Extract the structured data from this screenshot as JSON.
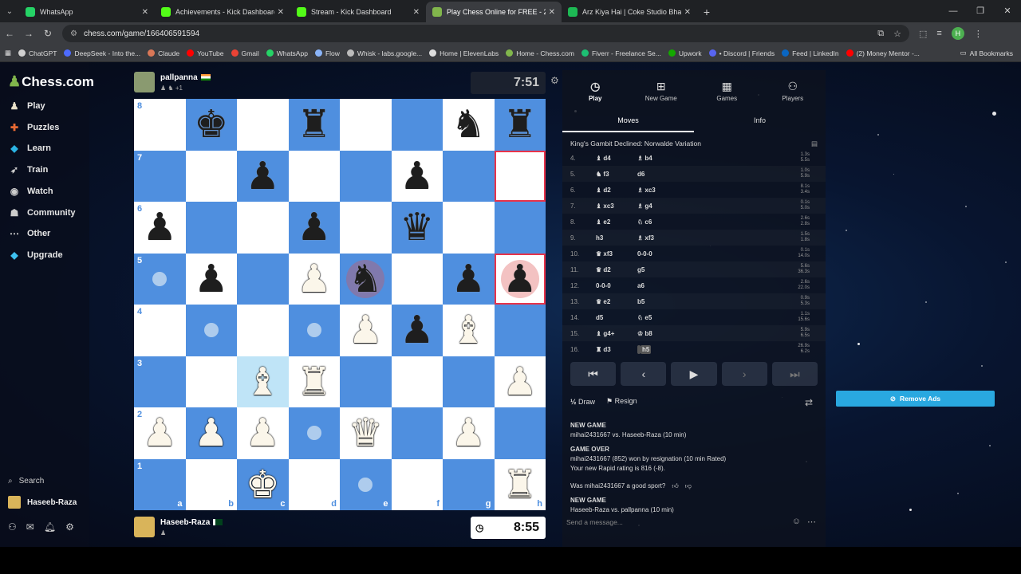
{
  "browser": {
    "tabs": [
      {
        "title": "WhatsApp",
        "icon": "whatsapp-icon",
        "color": "#25d366",
        "active": false
      },
      {
        "title": "Achievements - Kick Dashboard",
        "icon": "kick-icon",
        "color": "#53fc18",
        "active": false
      },
      {
        "title": "Stream - Kick Dashboard",
        "icon": "kick-icon",
        "color": "#53fc18",
        "active": false
      },
      {
        "title": "Play Chess Online for FREE - 2",
        "icon": "chess-icon",
        "color": "#81b64c",
        "active": true
      },
      {
        "title": "Arz Kiya Hai | Coke Studio Bhar",
        "icon": "spotify-icon",
        "color": "#1db954",
        "active": false
      }
    ],
    "url": "chess.com/game/166406591594",
    "bookmarks": [
      {
        "label": "ChatGPT",
        "color": "#d0d0d0"
      },
      {
        "label": "DeepSeek - Into the...",
        "color": "#4d6bfe"
      },
      {
        "label": "Claude",
        "color": "#d97757"
      },
      {
        "label": "YouTube",
        "color": "#ff0000"
      },
      {
        "label": "Gmail",
        "color": "#ea4335"
      },
      {
        "label": "WhatsApp",
        "color": "#25d366"
      },
      {
        "label": "Flow",
        "color": "#8ab4f8"
      },
      {
        "label": "Whisk - labs.google...",
        "color": "#bbbbbb"
      },
      {
        "label": "Home | ElevenLabs",
        "color": "#dddddd"
      },
      {
        "label": "Home - Chess.com",
        "color": "#81b64c"
      },
      {
        "label": "Fiverr - Freelance Se...",
        "color": "#1dbf73"
      },
      {
        "label": "Upwork",
        "color": "#14a800"
      },
      {
        "label": "• Discord | Friends",
        "color": "#5865f2"
      },
      {
        "label": "Feed | LinkedIn",
        "color": "#0a66c2"
      },
      {
        "label": "(2) Money Mentor -...",
        "color": "#ff0000"
      }
    ],
    "all_bookmarks": "All Bookmarks",
    "profile_initial": "H"
  },
  "sidebar": {
    "logo": "Chess.com",
    "items": [
      {
        "label": "Play",
        "icon": "play-icon",
        "color": "#e8e0c8"
      },
      {
        "label": "Puzzles",
        "icon": "puzzle-icon",
        "color": "#e86a33"
      },
      {
        "label": "Learn",
        "icon": "learn-icon",
        "color": "#2bb3e3"
      },
      {
        "label": "Train",
        "icon": "train-icon",
        "color": "#cccccc"
      },
      {
        "label": "Watch",
        "icon": "watch-icon",
        "color": "#cccccc"
      },
      {
        "label": "Community",
        "icon": "community-icon",
        "color": "#cccccc"
      },
      {
        "label": "Other",
        "icon": "more-icon",
        "color": "#cccccc"
      },
      {
        "label": "Upgrade",
        "icon": "diamond-icon",
        "color": "#3ec1f0"
      }
    ],
    "search": "Search",
    "user": "Haseeb-Raza"
  },
  "top_player": {
    "name": "pallpanna",
    "rating_note": "+1",
    "clock": "7:51"
  },
  "bottom_player": {
    "name": "Haseeb-Raza",
    "clock": "8:55"
  },
  "board": {
    "ranks": [
      "8",
      "7",
      "6",
      "5",
      "4",
      "3",
      "2",
      "1"
    ],
    "files": [
      "a",
      "b",
      "c",
      "d",
      "e",
      "f",
      "g",
      "h"
    ],
    "rows": [
      [
        "",
        "bk",
        "",
        "br",
        "",
        "",
        "bn",
        "br"
      ],
      [
        "",
        "",
        "bp",
        "",
        "",
        "bp",
        "",
        ""
      ],
      [
        "bp",
        "",
        "",
        "bp",
        "",
        "bq",
        "",
        ""
      ],
      [
        "",
        "bp",
        "",
        "wp",
        "bn",
        "",
        "bp",
        "bp"
      ],
      [
        "",
        "",
        "",
        "",
        "wp",
        "bp",
        "wb",
        ""
      ],
      [
        "",
        "",
        "wb",
        "wr",
        "",
        "",
        "",
        "wp"
      ],
      [
        "wp",
        "wp",
        "wp",
        "",
        "wq",
        "",
        "wp",
        ""
      ],
      [
        "",
        "",
        "wk",
        "",
        "",
        "",
        "",
        "wr"
      ]
    ],
    "last_move": [
      "h7",
      "h5"
    ],
    "selected": "c3",
    "move_hints": [
      "a5",
      "b4",
      "d4",
      "d2",
      "e1"
    ]
  },
  "panel": {
    "tabs": [
      {
        "label": "Play",
        "icon": "stopwatch-icon"
      },
      {
        "label": "New Game",
        "icon": "plus-icon"
      },
      {
        "label": "Games",
        "icon": "games-icon"
      },
      {
        "label": "Players",
        "icon": "players-icon"
      }
    ],
    "subtabs": [
      "Moves",
      "Info"
    ],
    "opening": "King's Gambit Declined: Norwalde Variation",
    "moves": [
      {
        "n": "4.",
        "w": "d4",
        "wi": "♝",
        "b": "b4",
        "bi": "♗",
        "wt": "1.3s",
        "bt": "5.5s"
      },
      {
        "n": "5.",
        "w": "f3",
        "wi": "♞",
        "b": "d6",
        "bi": "",
        "wt": "1.0s",
        "bt": "5.9s"
      },
      {
        "n": "6.",
        "w": "d2",
        "wi": "♝",
        "b": "xc3",
        "bi": "♗",
        "wt": "8.1s",
        "bt": "3.4s"
      },
      {
        "n": "7.",
        "w": "xc3",
        "wi": "♝",
        "b": "g4",
        "bi": "♗",
        "wt": "0.1s",
        "bt": "5.0s"
      },
      {
        "n": "8.",
        "w": "e2",
        "wi": "♝",
        "b": "c6",
        "bi": "♘",
        "wt": "2.6s",
        "bt": "2.8s"
      },
      {
        "n": "9.",
        "w": "h3",
        "wi": "",
        "b": "xf3",
        "bi": "♗",
        "wt": "1.5s",
        "bt": "1.8s"
      },
      {
        "n": "10.",
        "w": "xf3",
        "wi": "♛",
        "b": "0-0-0",
        "bi": "",
        "wt": "0.1s",
        "bt": "14.0s"
      },
      {
        "n": "11.",
        "w": "d2",
        "wi": "♛",
        "b": "g5",
        "bi": "",
        "wt": "5.6s",
        "bt": "36.3s"
      },
      {
        "n": "12.",
        "w": "0-0-0",
        "wi": "",
        "b": "a6",
        "bi": "",
        "wt": "2.6s",
        "bt": "22.0s"
      },
      {
        "n": "13.",
        "w": "e2",
        "wi": "♛",
        "b": "b5",
        "bi": "",
        "wt": "0.9s",
        "bt": "5.3s"
      },
      {
        "n": "14.",
        "w": "d5",
        "wi": "",
        "b": "e5",
        "bi": "♘",
        "wt": "1.1s",
        "bt": "15.6s"
      },
      {
        "n": "15.",
        "w": "g4+",
        "wi": "♝",
        "b": "b8",
        "bi": "♔",
        "wt": "5.9s",
        "bt": "6.5s"
      },
      {
        "n": "16.",
        "w": "d3",
        "wi": "♜",
        "b": "h5",
        "bi": "",
        "wt": "26.9s",
        "bt": "6.2s"
      }
    ],
    "draw": "Draw",
    "resign": "Resign",
    "log": {
      "new_game_1": "NEW GAME",
      "match_1": "mihai2431667 vs. Haseeb-Raza (10 min)",
      "game_over": "GAME OVER",
      "result": "mihai2431667 (852) won by resignation (10 min Rated)",
      "rating": "Your new Rapid rating is 816 (-8).",
      "ask": "Was mihai2431667 a good sport?",
      "new_game_2": "NEW GAME",
      "match_2": "Haseeb-Raza vs. pallpanna (10 min)"
    },
    "message_placeholder": "Send a message..."
  },
  "remove_ads": "Remove Ads"
}
